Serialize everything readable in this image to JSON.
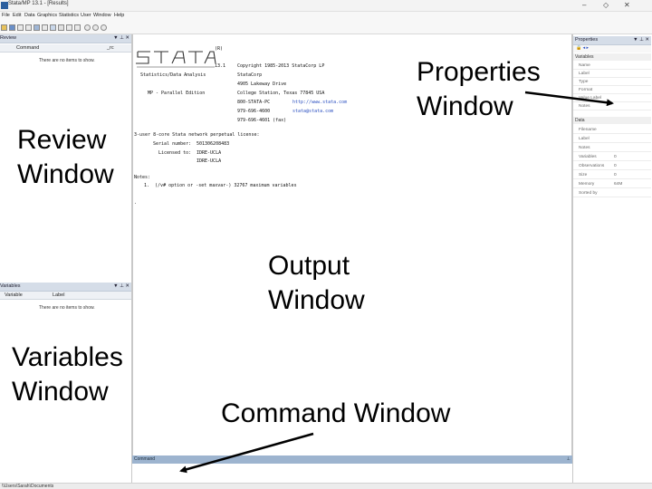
{
  "window": {
    "title": "Stata/MP 13.1 - [Results]",
    "minimize": "–",
    "restore": "◇",
    "close": "✕"
  },
  "menu": [
    "File",
    "Edit",
    "Data",
    "Graphics",
    "Statistics",
    "User",
    "Window",
    "Help"
  ],
  "review": {
    "title": "Review",
    "controls": "▼ ⊥ ✕",
    "col_command": "Command",
    "col_rc": "_rc",
    "empty": "There are no items to show."
  },
  "variables_panel": {
    "title": "Variables",
    "controls": "▼ ⊥ ✕",
    "col_variable": "Variable",
    "col_label": "Label",
    "empty": "There are no items to show."
  },
  "output": {
    "logo": "STATA",
    "registered": "(R)",
    "version": "13.1",
    "copyright": "Copyright 1985-2013 StataCorp LP",
    "company": "StataCorp",
    "address": "4905 Lakeway Drive",
    "city": "College Station, Texas 77845 USA",
    "phone1": "800-STATA-PC",
    "url": "http://www.stata.com",
    "phone2": "979-696-4600",
    "email": "stata@stata.com",
    "fax": "979-696-4601 (fax)",
    "subtitle": "Statistics/Data Analysis",
    "edition": "MP - Parallel Edition",
    "license_line": "3-user 8-core Stata network perpetual license:",
    "serial_label": "Serial number:",
    "serial": "501306208483",
    "licensed_label": "Licensed to:",
    "licensed1": "IDRE-UCLA",
    "licensed2": "IDRE-UCLA",
    "notes_label": "Notes:",
    "note1": "1.  (/v# option or -set maxvar-) 32767 maximum variables",
    "prompt": "."
  },
  "properties": {
    "title": "Properties",
    "controls": "▼ ⊥ ✕",
    "toolbar": "🔒 ◂ ▸",
    "variables_section": "Variables",
    "variables_fields": [
      {
        "key": "Name",
        "value": ""
      },
      {
        "key": "Label",
        "value": ""
      },
      {
        "key": "Type",
        "value": ""
      },
      {
        "key": "Format",
        "value": ""
      },
      {
        "key": "Value Label",
        "value": ""
      },
      {
        "key": "Notes",
        "value": ""
      }
    ],
    "data_section": "Data",
    "data_fields": [
      {
        "key": "Filename",
        "value": ""
      },
      {
        "key": "Label",
        "value": ""
      },
      {
        "key": "Notes",
        "value": ""
      },
      {
        "key": "Variables",
        "value": "0"
      },
      {
        "key": "Observations",
        "value": "0"
      },
      {
        "key": "Size",
        "value": "0"
      },
      {
        "key": "Memory",
        "value": "64M"
      },
      {
        "key": "Sorted by",
        "value": ""
      }
    ]
  },
  "command": {
    "title": "Command",
    "controls": "⊥"
  },
  "status": {
    "path": "\\\\Users\\Sarah\\Documents"
  },
  "annotations": {
    "review_line1": "Review",
    "review_line2": "Window",
    "properties_line1": "Properties",
    "properties_line2": "Window",
    "output_line1": "Output",
    "output_line2": "Window",
    "variables_line1": "Variables",
    "variables_line2": "Window",
    "command": "Command Window"
  }
}
